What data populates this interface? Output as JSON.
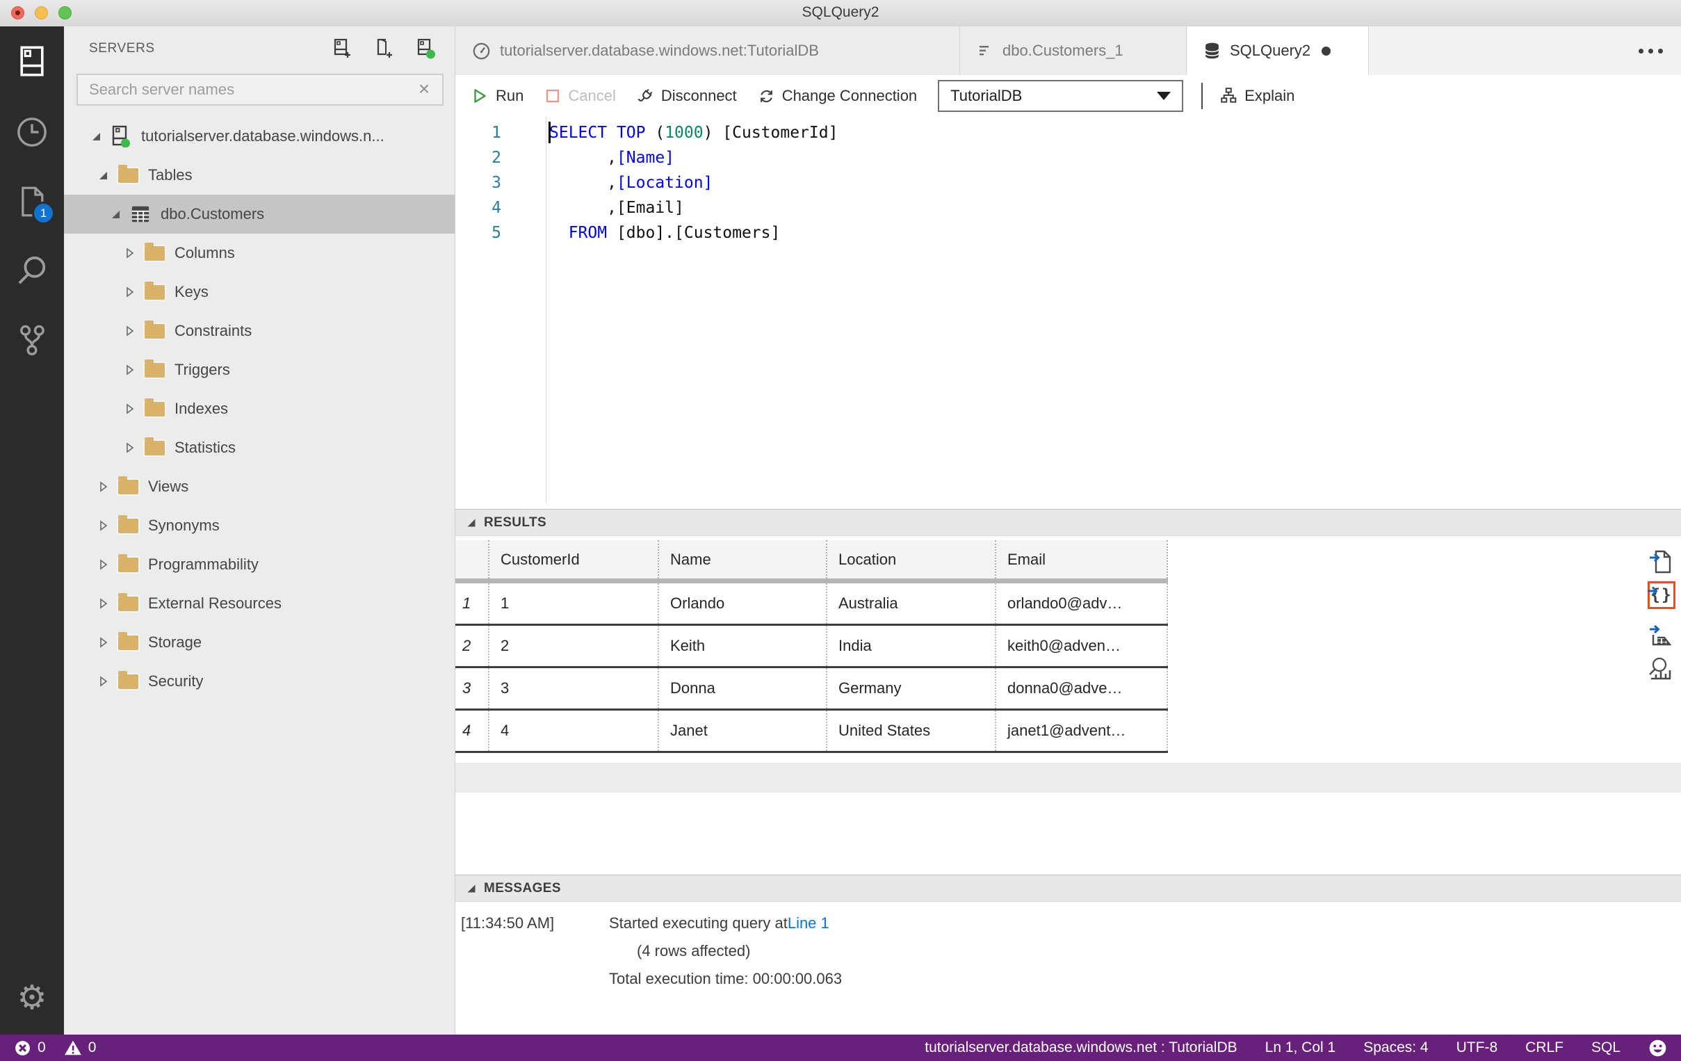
{
  "window": {
    "title": "SQLQuery2"
  },
  "activity_bar": {
    "badge": "1"
  },
  "sidebar": {
    "title": "SERVERS",
    "search": {
      "placeholder": "Search server names"
    },
    "tree": [
      {
        "label": "tutorialserver.database.windows.n...",
        "level": 0,
        "state": "expanded",
        "icon": "server",
        "selected": false
      },
      {
        "label": "Tables",
        "level": 1,
        "state": "expanded",
        "icon": "folder",
        "selected": false
      },
      {
        "label": "dbo.Customers",
        "level": 2,
        "state": "expanded",
        "icon": "table",
        "selected": true
      },
      {
        "label": "Columns",
        "level": 3,
        "state": "collapsed",
        "icon": "folder",
        "selected": false
      },
      {
        "label": "Keys",
        "level": 3,
        "state": "collapsed",
        "icon": "folder",
        "selected": false
      },
      {
        "label": "Constraints",
        "level": 3,
        "state": "collapsed",
        "icon": "folder",
        "selected": false
      },
      {
        "label": "Triggers",
        "level": 3,
        "state": "collapsed",
        "icon": "folder",
        "selected": false
      },
      {
        "label": "Indexes",
        "level": 3,
        "state": "collapsed",
        "icon": "folder",
        "selected": false
      },
      {
        "label": "Statistics",
        "level": 3,
        "state": "collapsed",
        "icon": "folder",
        "selected": false
      },
      {
        "label": "Views",
        "level": 1,
        "state": "collapsed",
        "icon": "folder",
        "selected": false
      },
      {
        "label": "Synonyms",
        "level": 1,
        "state": "collapsed",
        "icon": "folder",
        "selected": false
      },
      {
        "label": "Programmability",
        "level": 1,
        "state": "collapsed",
        "icon": "folder",
        "selected": false
      },
      {
        "label": "External Resources",
        "level": 1,
        "state": "collapsed",
        "icon": "folder",
        "selected": false
      },
      {
        "label": "Storage",
        "level": 1,
        "state": "collapsed",
        "icon": "folder",
        "selected": false
      },
      {
        "label": "Security",
        "level": 1,
        "state": "collapsed",
        "icon": "folder",
        "selected": false
      }
    ]
  },
  "tabs": [
    {
      "label": "tutorialserver.database.windows.net:TutorialDB",
      "icon": "dashboard",
      "active": false,
      "dirty": false
    },
    {
      "label": "dbo.Customers_1",
      "icon": "edit-data",
      "active": false,
      "dirty": false
    },
    {
      "label": "SQLQuery2",
      "icon": "database",
      "active": true,
      "dirty": true
    }
  ],
  "toolbar": {
    "run": "Run",
    "cancel": "Cancel",
    "disconnect": "Disconnect",
    "change_connection": "Change Connection",
    "database": "TutorialDB",
    "explain": "Explain"
  },
  "editor": {
    "lines": [
      {
        "num": "1",
        "segments": [
          {
            "t": "SELECT",
            "c": "kw"
          },
          {
            "t": " "
          },
          {
            "t": "TOP",
            "c": "kw"
          },
          {
            "t": " ("
          },
          {
            "t": "1000",
            "c": "num"
          },
          {
            "t": ") [CustomerId]"
          }
        ]
      },
      {
        "num": "2",
        "segments": [
          {
            "t": "      ,"
          },
          {
            "t": "[Name]",
            "c": "kw"
          }
        ]
      },
      {
        "num": "3",
        "segments": [
          {
            "t": "      ,"
          },
          {
            "t": "[Location]",
            "c": "kw"
          }
        ]
      },
      {
        "num": "4",
        "segments": [
          {
            "t": "      ,[Email]"
          }
        ]
      },
      {
        "num": "5",
        "segments": [
          {
            "t": "  "
          },
          {
            "t": "FROM",
            "c": "kw"
          },
          {
            "t": " [dbo].[Customers]"
          }
        ]
      }
    ]
  },
  "results": {
    "title": "RESULTS",
    "columns": [
      "CustomerId",
      "Name",
      "Location",
      "Email"
    ],
    "rows": [
      [
        "1",
        "1",
        "Orlando",
        "Australia",
        "orlando0@adv…"
      ],
      [
        "2",
        "2",
        "Keith",
        "India",
        "keith0@adven…"
      ],
      [
        "3",
        "3",
        "Donna",
        "Germany",
        "donna0@adve…"
      ],
      [
        "4",
        "4",
        "Janet",
        "United States",
        "janet1@advent…"
      ]
    ]
  },
  "messages": {
    "title": "MESSAGES",
    "entries": [
      {
        "time": "[11:34:50 AM]",
        "text": "Started executing query at ",
        "link": "Line 1",
        "indent": false
      },
      {
        "time": "",
        "text": "(4 rows affected)",
        "link": "",
        "indent": true
      },
      {
        "time": "",
        "text": "Total execution time: 00:00:00.063",
        "link": "",
        "indent": false
      }
    ]
  },
  "status_bar": {
    "errors": "0",
    "warnings": "0",
    "connection": "tutorialserver.database.windows.net : TutorialDB",
    "cursor": "Ln 1, Col 1",
    "spaces": "Spaces: 4",
    "encoding": "UTF-8",
    "eol": "CRLF",
    "language": "SQL"
  }
}
